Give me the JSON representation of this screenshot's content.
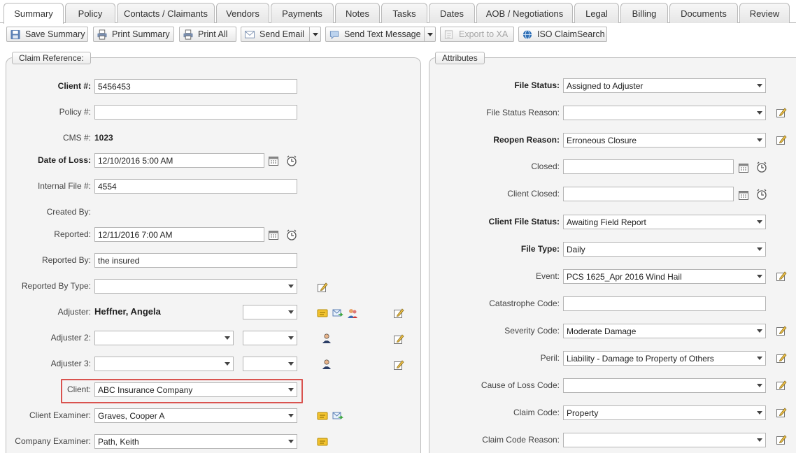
{
  "tabs": [
    {
      "label": "Summary",
      "active": true
    },
    {
      "label": "Policy"
    },
    {
      "label": "Contacts / Claimants"
    },
    {
      "label": "Vendors"
    },
    {
      "label": "Payments"
    },
    {
      "label": "Notes"
    },
    {
      "label": "Tasks"
    },
    {
      "label": "Dates"
    },
    {
      "label": "AOB / Negotiations"
    },
    {
      "label": "Legal"
    },
    {
      "label": "Billing"
    },
    {
      "label": "Documents"
    },
    {
      "label": "Review"
    }
  ],
  "toolbar": {
    "save_summary": "Save Summary",
    "print_summary": "Print Summary",
    "print_all": "Print All",
    "send_email": "Send Email",
    "send_text": "Send Text Message",
    "export_xa": "Export to XA",
    "iso_search": "ISO ClaimSearch"
  },
  "claim": {
    "legend": "Claim Reference:",
    "client_no_label": "Client #:",
    "client_no": "5456453",
    "policy_no_label": "Policy #:",
    "policy_no": "",
    "cms_label": "CMS #:",
    "cms": "1023",
    "date_of_loss_label": "Date of Loss:",
    "date_of_loss": "12/10/2016 5:00 AM",
    "internal_file_label": "Internal File #:",
    "internal_file": "4554",
    "created_by_label": "Created By:",
    "reported_label": "Reported:",
    "reported": "12/11/2016 7:00 AM",
    "reported_by_label": "Reported By:",
    "reported_by": "the insured",
    "reported_by_type_label": "Reported By Type:",
    "reported_by_type": "",
    "adjuster_label": "Adjuster:",
    "adjuster": "Heffner, Angela",
    "adjuster2_label": "Adjuster 2:",
    "adjuster3_label": "Adjuster 3:",
    "client_label": "Client:",
    "client": "ABC Insurance Company",
    "client_examiner_label": "Client Examiner:",
    "client_examiner": "Graves, Cooper A",
    "company_examiner_label": "Company Examiner:",
    "company_examiner": "Path, Keith"
  },
  "attributes": {
    "legend": "Attributes",
    "file_status_label": "File Status:",
    "file_status": "Assigned to Adjuster",
    "file_status_reason_label": "File Status Reason:",
    "file_status_reason": "",
    "reopen_reason_label": "Reopen Reason:",
    "reopen_reason": "Erroneous Closure",
    "closed_label": "Closed:",
    "closed": "",
    "client_closed_label": "Client Closed:",
    "client_closed": "",
    "client_file_status_label": "Client File Status:",
    "client_file_status": "Awaiting Field Report",
    "file_type_label": "File Type:",
    "file_type": "Daily",
    "event_label": "Event:",
    "event": "PCS 1625_Apr 2016 Wind Hail",
    "catastrophe_code_label": "Catastrophe Code:",
    "catastrophe_code": "",
    "severity_code_label": "Severity Code:",
    "severity_code": "Moderate Damage",
    "peril_label": "Peril:",
    "peril": "Liability - Damage to Property of Others",
    "cause_of_loss_label": "Cause of Loss Code:",
    "cause_of_loss": "",
    "claim_code_label": "Claim Code:",
    "claim_code": "Property",
    "claim_code_reason_label": "Claim Code Reason:",
    "claim_code_reason": ""
  },
  "colors": {
    "highlight": "#d9534f",
    "panel_bg": "#f4f4f4",
    "border": "#bdbdbd"
  }
}
